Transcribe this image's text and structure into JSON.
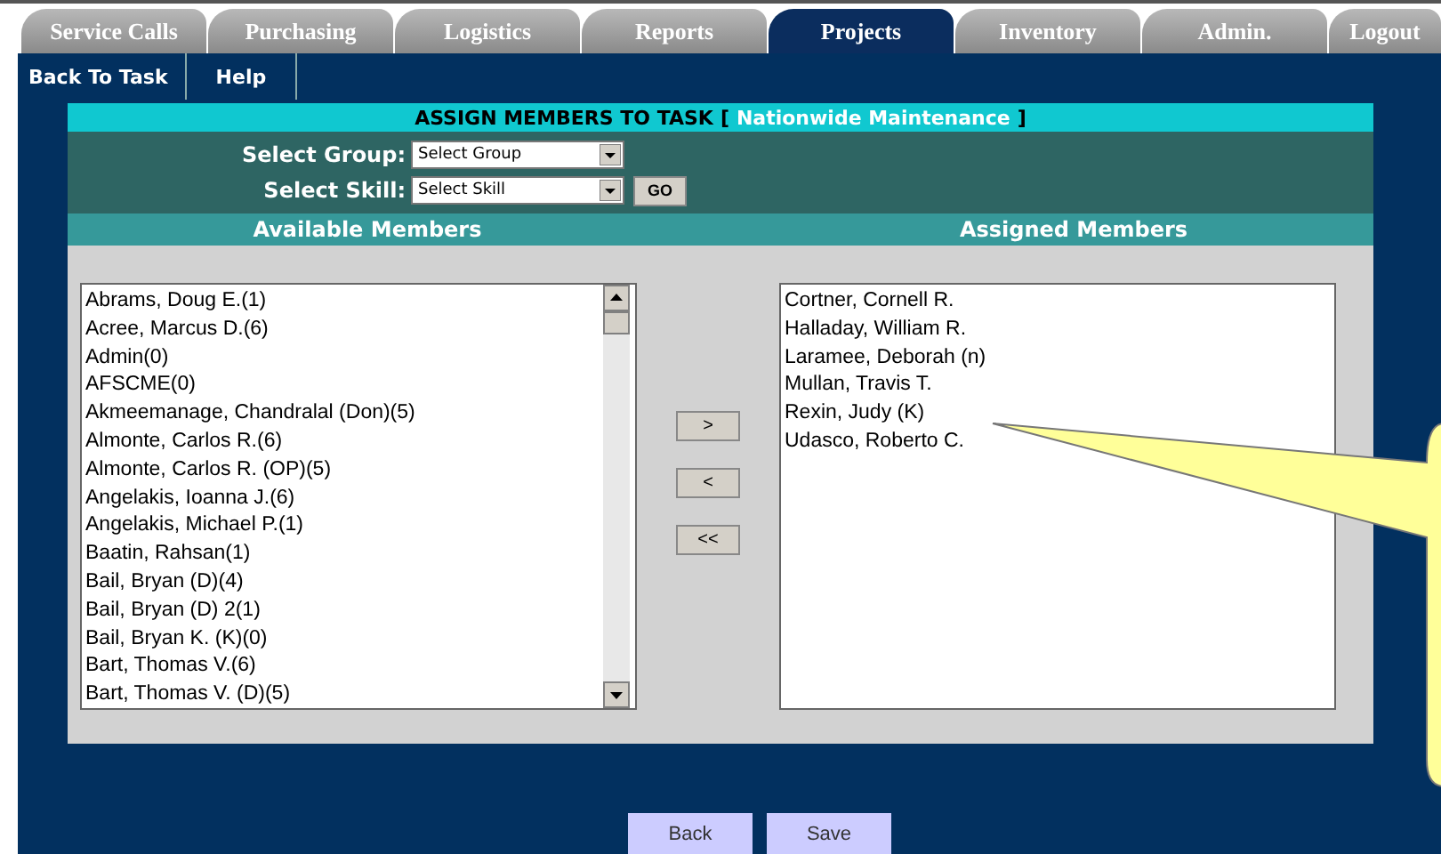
{
  "tabs": [
    {
      "label": "Service Calls",
      "selected": false
    },
    {
      "label": "Purchasing",
      "selected": false
    },
    {
      "label": "Logistics",
      "selected": false
    },
    {
      "label": "Reports",
      "selected": false
    },
    {
      "label": "Projects",
      "selected": true
    },
    {
      "label": "Inventory",
      "selected": false
    },
    {
      "label": "Admin.",
      "selected": false
    },
    {
      "label": "Logout",
      "selected": false
    }
  ],
  "subnav": [
    "Back To Task",
    "Help"
  ],
  "header": {
    "title": "ASSIGN MEMBERS TO TASK",
    "open_bracket": "[",
    "task": "Nationwide Maintenance",
    "close_bracket": "]"
  },
  "filters": [
    {
      "label": "Select Group:",
      "value": "Select Group"
    },
    {
      "label": "Select Skill:",
      "value": "Select Skill",
      "go": "GO"
    }
  ],
  "columns": [
    "Available Members",
    "Assigned Members"
  ],
  "available_members": [
    "Abrams, Doug E.(1)",
    "Acree, Marcus D.(6)",
    "Admin(0)",
    "AFSCME(0)",
    "Akmeemanage, Chandralal (Don)(5)",
    "Almonte, Carlos R.(6)",
    "Almonte, Carlos R. (OP)(5)",
    "Angelakis, Ioanna J.(6)",
    "Angelakis, Michael P.(1)",
    "Baatin, Rahsan(1)",
    "Bail, Bryan (D)(4)",
    "Bail, Bryan (D) 2(1)",
    "Bail, Bryan K. (K)(0)",
    "Bart, Thomas V.(6)",
    "Bart, Thomas V. (D)(5)"
  ],
  "move_buttons": [
    ">",
    "<",
    "<<"
  ],
  "assigned_members": [
    "Cortner, Cornell R.",
    "Halladay, William R.",
    "Laramee, Deborah (n)",
    "Mullan, Travis T.",
    "Rexin, Judy (K)",
    "Udasco, Roberto C."
  ],
  "buttons": [
    "Back",
    "Save"
  ]
}
